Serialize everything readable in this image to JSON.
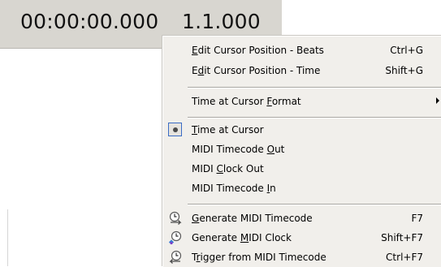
{
  "time_display": {
    "time": "00:00:00.000",
    "beats": "1.1.000"
  },
  "menu": {
    "edit_beats": {
      "pre": "",
      "key": "E",
      "post": "dit Cursor Position - Beats",
      "shortcut": "Ctrl+G"
    },
    "edit_time": {
      "pre": "E",
      "key": "d",
      "post": "it Cursor Position - Time",
      "shortcut": "Shift+G"
    },
    "format": {
      "pre": "Time at Cursor ",
      "key": "F",
      "post": "ormat"
    },
    "time_at_cursor": {
      "pre": "",
      "key": "T",
      "post": "ime at Cursor"
    },
    "timecode_out": {
      "pre": "MIDI Timecode ",
      "key": "O",
      "post": "ut"
    },
    "clock_out": {
      "pre": "MIDI ",
      "key": "C",
      "post": "lock Out"
    },
    "timecode_in": {
      "pre": "MIDI Timecode ",
      "key": "I",
      "post": "n"
    },
    "gen_timecode": {
      "pre": "",
      "key": "G",
      "post": "enerate MIDI Timecode",
      "shortcut": "F7",
      "icon": "clock-generate-icon"
    },
    "gen_clock": {
      "pre": "Generate ",
      "key": "M",
      "post": "IDI Clock",
      "shortcut": "Shift+F7",
      "icon": "clock-midi-icon"
    },
    "trigger": {
      "pre": "T",
      "key": "r",
      "post": "igger from MIDI Timecode",
      "shortcut": "Ctrl+F7",
      "icon": "clock-trigger-icon"
    }
  },
  "colors": {
    "menu_bg": "#f1efeb",
    "display_bg": "#d8d6d0",
    "selection_border": "#3a6cc5"
  }
}
